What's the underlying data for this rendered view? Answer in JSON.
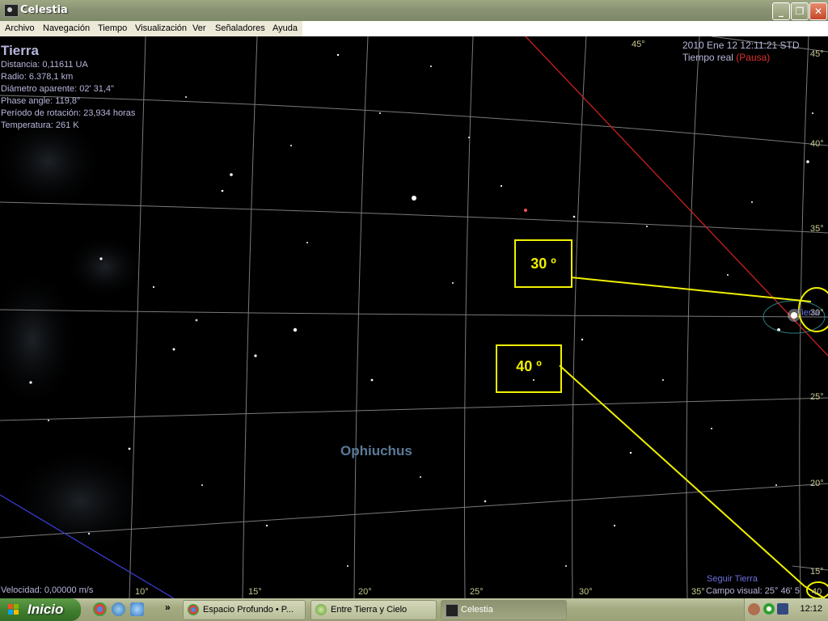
{
  "window": {
    "title": "Celestia",
    "controls": [
      "minimize-icon",
      "restore-icon",
      "close-icon"
    ]
  },
  "menu": [
    "Archivo",
    "Navegación",
    "Tiempo",
    "Visualización",
    "Ver",
    "Señaladores",
    "Ayuda"
  ],
  "info": {
    "object": "Tierra",
    "lines": [
      "Distancia: 0,11611 UA",
      "Radio: 6.378,1 km",
      "Diámetro aparente: 02' 31,4\"",
      "Phase angle: 119,8°",
      "Período de rotación: 23,934 horas",
      "Temperatura: 261 K"
    ]
  },
  "time": {
    "datetime": "2010 Ene 12 12:11:21 STD",
    "mode": "Tiempo real",
    "paused": "(Pausa)"
  },
  "grid": {
    "bottom_labels": [
      "10°",
      "15°",
      "20°",
      "25°",
      "30°",
      "35°"
    ],
    "right_labels": [
      "45°",
      "40°",
      "35°",
      "30°",
      "25°",
      "20°",
      "15°",
      "40"
    ],
    "top_label": "45°"
  },
  "constellation": "Ophiuchus",
  "target_label": "Tierra",
  "annotations": {
    "box1": "30 º",
    "box2": "40 º"
  },
  "status": {
    "velocity": "Velocidad: 0,00000 m/s",
    "follow": "Seguir Tierra",
    "fov": "Campo visual: 25° 46' 5"
  },
  "taskbar": {
    "start": "Inicio",
    "tasks": [
      "Espacio Profundo • P...",
      "Entre Tierra y  Cielo",
      "Celestia"
    ],
    "clock": "12:12",
    "overflow": "»"
  },
  "colors": {
    "annotation": "#f0f000",
    "hud_text": "#b7b7dc",
    "pause": "#e03030",
    "grid": "#8a8a8a",
    "ecliptic": "#cc2020",
    "galactic": "#3b3bd0",
    "constellation": "#5a7a98"
  }
}
